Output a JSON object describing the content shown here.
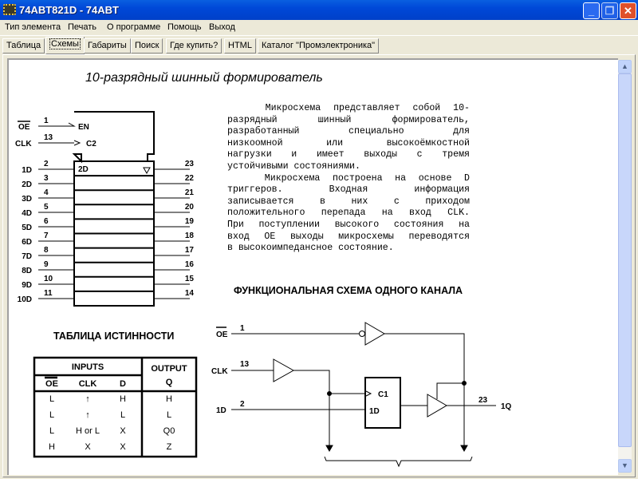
{
  "window": {
    "title": "74ABT821D -  74ABT"
  },
  "menu": [
    "Тип элемента",
    "Печать",
    "О программе",
    "Помощь",
    "Выход"
  ],
  "tabs": [
    "Таблица",
    "Схемы",
    "Габариты",
    "Поиск",
    "Где купить?",
    "HTML",
    "Каталог \"Промэлектроника\""
  ],
  "active_tab": "Схемы",
  "page": {
    "title": "10-разрядный шинный формирователь",
    "description_lines": [
      "   Микросхема представляет собой 10-",
      "разрядный шинный формирователь,",
      "разработанный специально для",
      "низкоомной или высокоёмкостной",
      "нагрузки и имеет выходы с тремя",
      "устойчивыми состояниями.",
      "   Микросхема построена на основе D",
      "триггеров. Входная информация",
      "записывается в них с приходом",
      "положительного перепада на вход CLK.",
      "При поступлении высокого состояния на",
      "вход OE выходы микросхемы переводятся",
      "в высокоимпедансное состояние."
    ],
    "chip": {
      "oe_label": "OE",
      "oe_pin": "1",
      "clk_label": "CLK",
      "clk_pin": "13",
      "en_label": "EN",
      "c2_label": "C2",
      "d_label": "2D",
      "inputs": [
        {
          "label": "1D",
          "pin": "2"
        },
        {
          "label": "2D",
          "pin": "3"
        },
        {
          "label": "3D",
          "pin": "4"
        },
        {
          "label": "4D",
          "pin": "5"
        },
        {
          "label": "5D",
          "pin": "6"
        },
        {
          "label": "6D",
          "pin": "7"
        },
        {
          "label": "7D",
          "pin": "8"
        },
        {
          "label": "8D",
          "pin": "9"
        },
        {
          "label": "9D",
          "pin": "10"
        },
        {
          "label": "10D",
          "pin": "11"
        }
      ],
      "outputs": [
        "23",
        "22",
        "21",
        "20",
        "19",
        "18",
        "17",
        "16",
        "15",
        "14"
      ]
    },
    "truth_table": {
      "title": "ТАБЛИЦА ИСТИННОСТИ",
      "inputs_header": "INPUTS",
      "output_header": "OUTPUT",
      "output_sub": "Q",
      "columns": [
        "OE",
        "CLK",
        "D"
      ],
      "rows": [
        [
          "L",
          "↑",
          "H",
          "H"
        ],
        [
          "L",
          "↑",
          "L",
          "L"
        ],
        [
          "L",
          "H or L",
          "X",
          "Q0"
        ],
        [
          "H",
          "X",
          "X",
          "Z"
        ]
      ]
    },
    "functional": {
      "title": "ФУНКЦИОНАЛЬНАЯ СХЕМА ОДНОГО КАНАЛА",
      "oe_label": "OE",
      "oe_pin": "1",
      "clk_label": "CLK",
      "clk_pin": "13",
      "d_label": "1D",
      "d_pin": "2",
      "ff_c": "C1",
      "ff_d": "1D",
      "out_pin": "23",
      "out_label": "1Q"
    }
  }
}
